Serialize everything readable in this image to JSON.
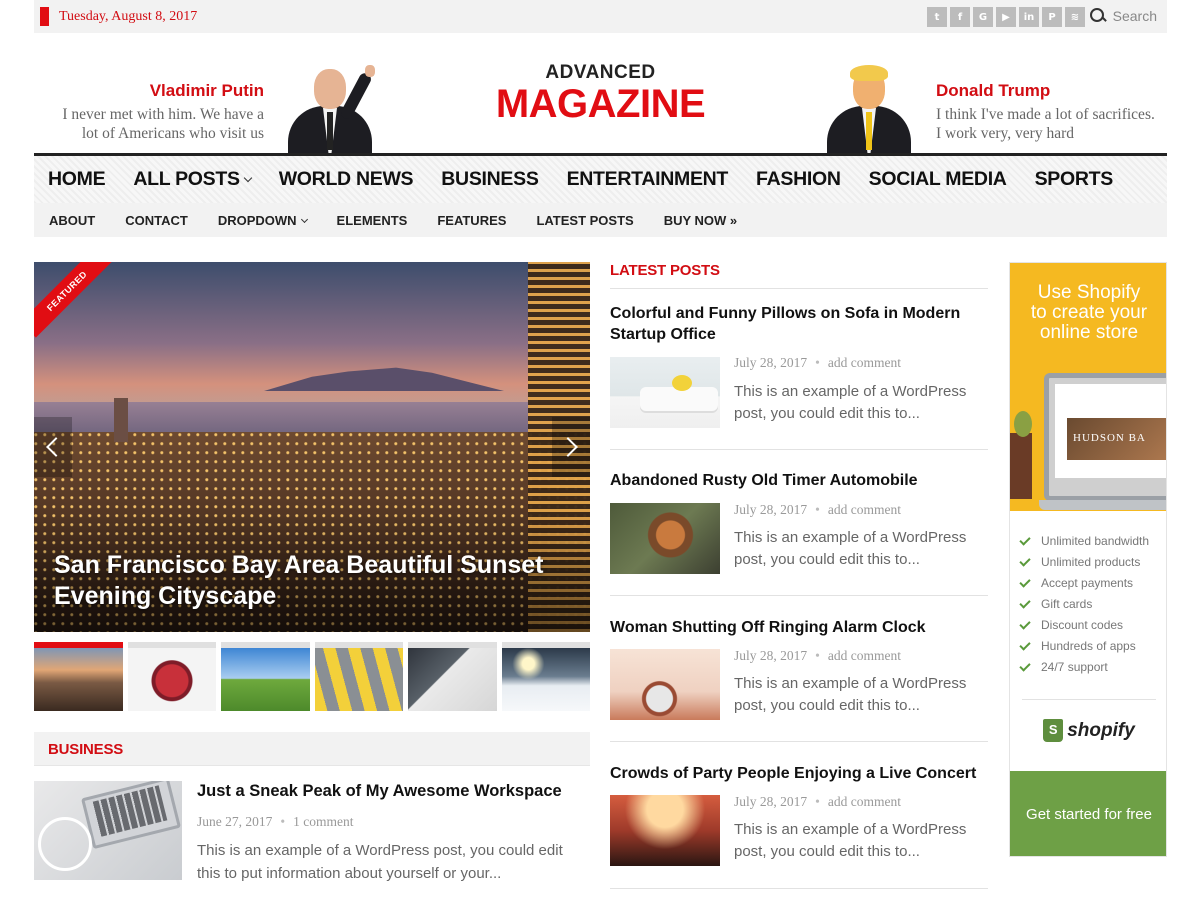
{
  "topbar": {
    "date": "Tuesday, August 8, 2017",
    "social_icons": [
      "twitter-icon",
      "facebook-icon",
      "google-plus-icon",
      "youtube-icon",
      "linkedin-icon",
      "pinterest-icon",
      "rss-icon"
    ],
    "search_label": "Search"
  },
  "header": {
    "left_quote": {
      "name": "Vladimir Putin",
      "line1": "I never met with him. We have a",
      "line2": "lot of Americans who visit us"
    },
    "right_quote": {
      "name": "Donald Trump",
      "line1": "I think I've made a lot of sacrifices.",
      "line2": "I work very, very hard"
    },
    "logo": {
      "line1": "ADVANCED",
      "line2": "MAGAZINE"
    }
  },
  "main_nav": [
    {
      "label": "HOME"
    },
    {
      "label": "ALL POSTS",
      "dropdown": true
    },
    {
      "label": "WORLD NEWS"
    },
    {
      "label": "BUSINESS"
    },
    {
      "label": "ENTERTAINMENT"
    },
    {
      "label": "FASHION"
    },
    {
      "label": "SOCIAL MEDIA"
    },
    {
      "label": "SPORTS"
    }
  ],
  "sub_nav": [
    {
      "label": "ABOUT"
    },
    {
      "label": "CONTACT"
    },
    {
      "label": "DROPDOWN",
      "dropdown": true
    },
    {
      "label": "ELEMENTS"
    },
    {
      "label": "FEATURES"
    },
    {
      "label": "LATEST POSTS"
    },
    {
      "label": "BUY NOW »"
    }
  ],
  "slider": {
    "ribbon": "FEATURED",
    "caption_line1": "San Francisco Bay Area Beautiful Sunset",
    "caption_line2": "Evening Cityscape",
    "active_index": 0
  },
  "business": {
    "label": "BUSINESS",
    "post": {
      "title": "Just a Sneak Peak of My Awesome Workspace",
      "date": "June 27, 2017",
      "comments": "1 comment",
      "excerpt_line1": "This is an example of a WordPress post, you could edit",
      "excerpt_line2": "this to put information about yourself or your..."
    }
  },
  "latest": {
    "label": "LATEST POSTS",
    "posts": [
      {
        "title_line1": "Colorful and Funny Pillows on Sofa in Modern",
        "title_line2": "Startup Office",
        "date": "July 28, 2017",
        "comments": "add comment",
        "excerpt_line1": "This is an example of a WordPress",
        "excerpt_line2": "post, you could edit this to..."
      },
      {
        "title_line1": "Abandoned Rusty Old Timer Automobile",
        "title_line2": "",
        "date": "July 28, 2017",
        "comments": "add comment",
        "excerpt_line1": "This is an example of a WordPress",
        "excerpt_line2": "post, you could edit this to..."
      },
      {
        "title_line1": "Woman Shutting Off Ringing Alarm Clock",
        "title_line2": "",
        "date": "July 28, 2017",
        "comments": "add comment",
        "excerpt_line1": "This is an example of a WordPress",
        "excerpt_line2": "post, you could edit this to..."
      },
      {
        "title_line1": "Crowds of Party People Enjoying a Live Concert",
        "title_line2": "",
        "date": "July 28, 2017",
        "comments": "add comment",
        "excerpt_line1": "This is an example of a WordPress",
        "excerpt_line2": "post, you could edit this to..."
      }
    ]
  },
  "ad": {
    "headline_line1": "Use Shopify",
    "headline_line2": "to create your",
    "headline_line3": "online store",
    "screen_brand": "HUDSON BA",
    "features": [
      "Unlimited bandwidth",
      "Unlimited products",
      "Accept payments",
      "Gift cards",
      "Discount codes",
      "Hundreds of apps",
      "24/7 support"
    ],
    "brand": "shopify",
    "cta": "Get started for free"
  },
  "colors": {
    "accent": "#e10d13",
    "shopify_yellow": "#f5b921",
    "shopify_green": "#6ea046"
  }
}
